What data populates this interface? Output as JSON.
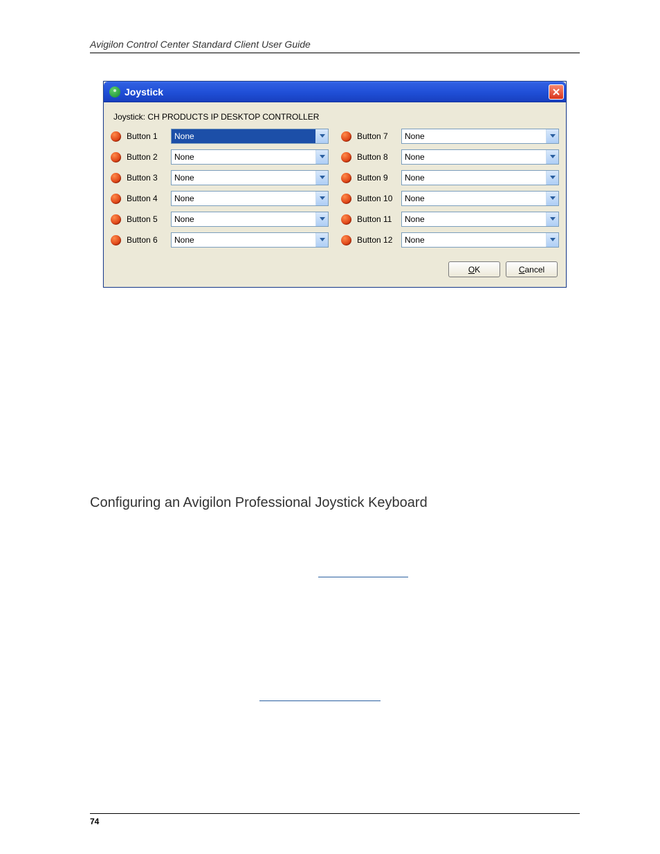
{
  "doc_header": "Avigilon Control Center Standard Client User Guide",
  "dialog": {
    "title": "Joystick",
    "device_label": "Joystick: CH PRODUCTS IP DESKTOP CONTROLLER",
    "buttons_left": [
      {
        "label": "Button 1",
        "value": "None",
        "selected": true
      },
      {
        "label": "Button 2",
        "value": "None",
        "selected": false
      },
      {
        "label": "Button 3",
        "value": "None",
        "selected": false
      },
      {
        "label": "Button 4",
        "value": "None",
        "selected": false
      },
      {
        "label": "Button 5",
        "value": "None",
        "selected": false
      },
      {
        "label": "Button 6",
        "value": "None",
        "selected": false
      }
    ],
    "buttons_right": [
      {
        "label": "Button 7",
        "value": "None",
        "selected": false
      },
      {
        "label": "Button 8",
        "value": "None",
        "selected": false
      },
      {
        "label": "Button 9",
        "value": "None",
        "selected": false
      },
      {
        "label": "Button 10",
        "value": "None",
        "selected": false
      },
      {
        "label": "Button 11",
        "value": "None",
        "selected": false
      },
      {
        "label": "Button 12",
        "value": "None",
        "selected": false
      }
    ],
    "ok_label": "OK",
    "cancel_label": "Cancel"
  },
  "section_heading": "Configuring an Avigilon Professional Joystick Keyboard",
  "page_number": "74"
}
